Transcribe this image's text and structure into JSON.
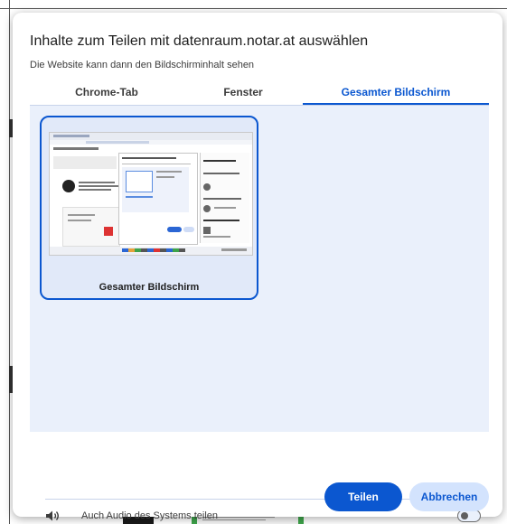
{
  "dialog": {
    "title": "Inhalte zum Teilen mit datenraum.notar.at auswählen",
    "subtitle": "Die Website kann dann den Bildschirminhalt sehen"
  },
  "tabs": [
    {
      "label": "Chrome-Tab",
      "selected": false
    },
    {
      "label": "Fenster",
      "selected": false
    },
    {
      "label": "Gesamter Bildschirm",
      "selected": true
    }
  ],
  "sources": [
    {
      "label": "Gesamter Bildschirm",
      "selected": true
    }
  ],
  "audio": {
    "label": "Auch Audio des Systems teilen",
    "enabled": false
  },
  "buttons": {
    "share": "Teilen",
    "cancel": "Abbrechen"
  },
  "colors": {
    "accent": "#0b57d0",
    "panel": "#eaf0fb",
    "secondary_button": "#d3e3fd"
  },
  "icons": {
    "audio": "speaker-icon",
    "toggle": "toggle-switch"
  }
}
